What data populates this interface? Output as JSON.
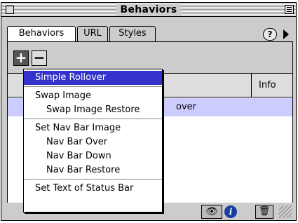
{
  "window": {
    "title": "Behaviors"
  },
  "tabs": [
    {
      "label": "Behaviors",
      "active": true
    },
    {
      "label": "URL",
      "active": false
    },
    {
      "label": "Styles",
      "active": false
    }
  ],
  "toolbar": {
    "add_label": "+",
    "remove_label": "−",
    "help_label": "?"
  },
  "table": {
    "columns": [
      "",
      "Info"
    ],
    "rows": [
      {
        "event": "",
        "action_fragment": "over",
        "selected": true
      }
    ]
  },
  "status": {
    "eye_glyph": "👁",
    "info_glyph": "i",
    "trash_glyph": "🗑"
  },
  "popup_menu": {
    "groups": [
      [
        {
          "label": "Simple Rollover",
          "indent": false,
          "highlighted": true
        }
      ],
      [
        {
          "label": "Swap Image",
          "indent": false
        },
        {
          "label": "Swap Image Restore",
          "indent": true
        }
      ],
      [
        {
          "label": "Set Nav Bar Image",
          "indent": false
        },
        {
          "label": "Nav Bar Over",
          "indent": true
        },
        {
          "label": "Nav Bar Down",
          "indent": true
        },
        {
          "label": "Nav Bar Restore",
          "indent": true
        }
      ],
      [
        {
          "label": "Set Text of Status Bar",
          "indent": false
        }
      ]
    ]
  },
  "colors": {
    "highlight": "#3333cc",
    "selected_row": "#ccccff",
    "info_icon": "#1a3fa0"
  }
}
